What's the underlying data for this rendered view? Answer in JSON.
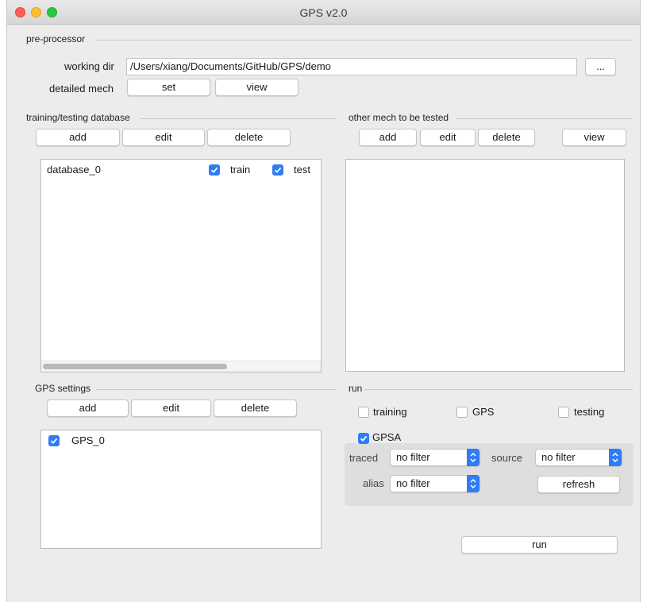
{
  "window": {
    "title": "GPS v2.0"
  },
  "preprocessor": {
    "group_label": "pre-processor",
    "working_dir_label": "working dir",
    "working_dir_value": "/Users/xiang/Documents/GitHub/GPS/demo",
    "browse_label": "...",
    "detailed_mech_label": "detailed mech",
    "set_label": "set",
    "view_label": "view"
  },
  "training_db": {
    "group_label": "training/testing database",
    "add_label": "add",
    "edit_label": "edit",
    "delete_label": "delete",
    "items": [
      {
        "name": "database_0",
        "train_label": "train",
        "train_checked": true,
        "test_label": "test",
        "test_checked": true
      }
    ]
  },
  "other_mech": {
    "group_label": "other mech to be tested",
    "add_label": "add",
    "edit_label": "edit",
    "delete_label": "delete",
    "view_label": "view"
  },
  "gps_settings": {
    "group_label": "GPS settings",
    "add_label": "add",
    "edit_label": "edit",
    "delete_label": "delete",
    "items": [
      {
        "name": "GPS_0",
        "checked": true
      }
    ]
  },
  "run": {
    "group_label": "run",
    "training_label": "training",
    "training_checked": false,
    "gps_label": "GPS",
    "gps_checked": false,
    "testing_label": "testing",
    "testing_checked": false,
    "gpsa_label": "GPSA",
    "gpsa_checked": true,
    "traced_label": "traced",
    "traced_value": "no filter",
    "source_label": "source",
    "source_value": "no filter",
    "alias_label": "alias",
    "alias_value": "no filter",
    "refresh_label": "refresh",
    "run_label": "run"
  },
  "colors": {
    "accent": "#2f7cf6",
    "window_bg": "#ececec"
  }
}
